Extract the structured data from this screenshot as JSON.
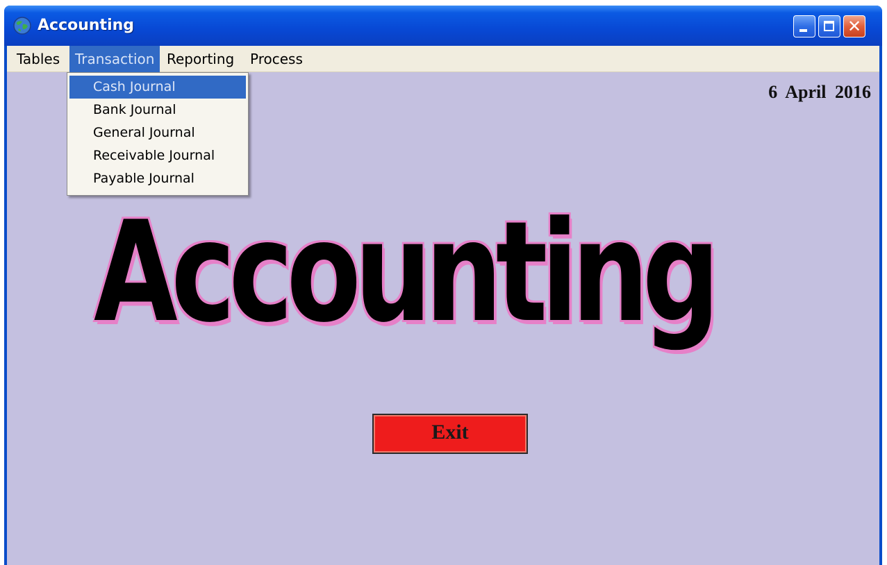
{
  "window": {
    "title": "Accounting",
    "icon": "globe-icon",
    "controls": {
      "minimize": "minimize-icon",
      "maximize": "maximize-icon",
      "close": "close-icon",
      "close_glyph": "✕"
    }
  },
  "menubar": {
    "items": [
      {
        "label": "Tables"
      },
      {
        "label": "Transaction",
        "active": true
      },
      {
        "label": "Reporting"
      },
      {
        "label": "Process"
      }
    ]
  },
  "transaction_menu": {
    "items": [
      {
        "label": "Cash Journal",
        "selected": true
      },
      {
        "label": "Bank Journal"
      },
      {
        "label": "General Journal"
      },
      {
        "label": "Receivable Journal"
      },
      {
        "label": "Payable Journal"
      }
    ]
  },
  "main": {
    "date": "6 April 2016",
    "banner": "Accounting",
    "exit_label": "Exit"
  },
  "colors": {
    "client_background": "#c4c0e0",
    "exit_button": "#ee1c1c",
    "banner_outline": "#e680c8",
    "selection": "#316ac5"
  }
}
